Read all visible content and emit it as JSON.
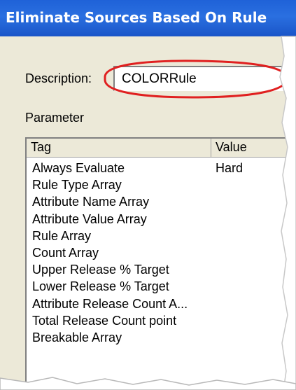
{
  "window": {
    "title": "Eliminate Sources Based On Rule"
  },
  "description": {
    "label": "Description:",
    "value": "COLORRule"
  },
  "parameter": {
    "label": "Parameter",
    "columns": {
      "tag": "Tag",
      "value": "Value"
    },
    "rows": [
      {
        "tag": "Always Evaluate",
        "value": "Hard"
      },
      {
        "tag": "Rule Type Array",
        "value": ""
      },
      {
        "tag": "Attribute Name Array",
        "value": ""
      },
      {
        "tag": "Attribute Value Array",
        "value": ""
      },
      {
        "tag": "Rule Array",
        "value": ""
      },
      {
        "tag": "Count Array",
        "value": ""
      },
      {
        "tag": "Upper Release % Target",
        "value": ""
      },
      {
        "tag": "Lower Release % Target",
        "value": ""
      },
      {
        "tag": "Attribute Release Count A...",
        "value": ""
      },
      {
        "tag": "Total Release Count point",
        "value": ""
      },
      {
        "tag": "Breakable Array",
        "value": ""
      }
    ]
  },
  "colors": {
    "titlebar": "#2a6fe0",
    "highlight": "#e02020",
    "dialog_bg": "#ece9d8"
  }
}
